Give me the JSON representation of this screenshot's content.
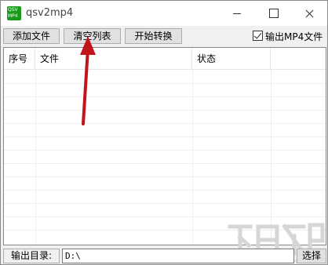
{
  "window": {
    "title": "qsv2mp4",
    "app_icon": "qsv-mp4-app-icon"
  },
  "toolbar": {
    "add_file_label": "添加文件",
    "clear_list_label": "清空列表",
    "start_convert_label": "开始转换",
    "output_mp4_label": "输出MP4文件",
    "output_mp4_checked": true
  },
  "list": {
    "columns": [
      "序号",
      "文件",
      "状态"
    ],
    "rows": []
  },
  "output": {
    "dir_label": "输出目录:",
    "dir_value": "D:\\",
    "browse_label": "选择"
  },
  "colors": {
    "arrow": "#c0161b",
    "app_icon_bg": "#1a9a1a",
    "watermark": "#d9d9d9"
  }
}
